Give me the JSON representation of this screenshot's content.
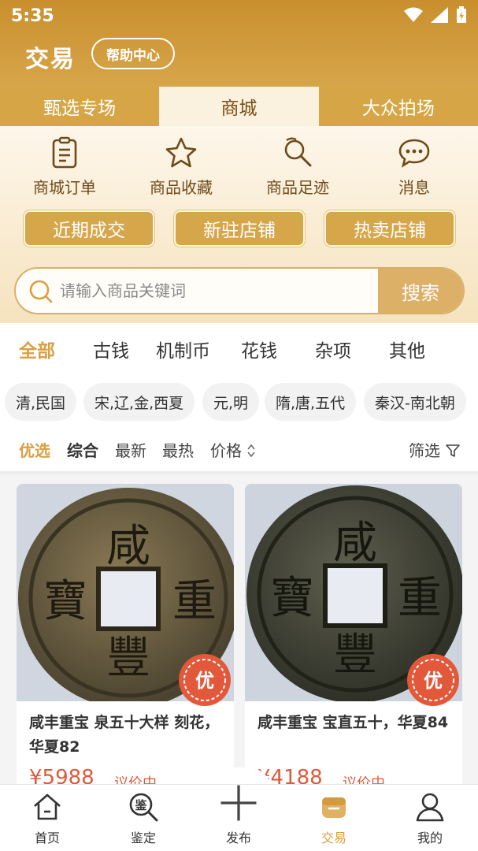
{
  "status_bar": {
    "time": "5:35"
  },
  "header": {
    "title": "交易",
    "help_label": "帮助中心"
  },
  "tabs": [
    {
      "label": "甄选专场",
      "active": false
    },
    {
      "label": "商城",
      "active": true
    },
    {
      "label": "大众拍场",
      "active": false
    }
  ],
  "quick_actions": [
    {
      "label": "商城订单",
      "icon": "order-icon"
    },
    {
      "label": "商品收藏",
      "icon": "star-icon"
    },
    {
      "label": "商品足迹",
      "icon": "footprint-icon"
    },
    {
      "label": "消息",
      "icon": "message-icon"
    }
  ],
  "action_buttons": [
    {
      "label": "近期成交"
    },
    {
      "label": "新驻店铺"
    },
    {
      "label": "热卖店铺"
    }
  ],
  "search": {
    "placeholder": "请输入商品关键词",
    "button_label": "搜索"
  },
  "categories": [
    "全部",
    "古钱",
    "机制币",
    "花钱",
    "杂项",
    "其他"
  ],
  "chips": [
    "清,民国",
    "宋,辽,金,西夏",
    "元,明",
    "隋,唐,五代",
    "秦汉-南北朝"
  ],
  "sort": {
    "options": [
      "优选",
      "综合",
      "最新",
      "最热",
      "价格"
    ],
    "filter_label": "筛选"
  },
  "products": [
    {
      "name": "咸丰重宝 泉五十大样 刻花，华夏82",
      "price": "¥5988",
      "price_note": "议价中",
      "badge": "优",
      "coin_chars": [
        "咸",
        "重",
        "豐",
        "寶"
      ]
    },
    {
      "name": "咸丰重宝 宝直五十，华夏84",
      "price": "¥4188",
      "price_note": "议价中",
      "badge": "优",
      "coin_chars": [
        "咸",
        "重",
        "豐",
        "寶"
      ]
    }
  ],
  "bottom_nav": [
    {
      "label": "首页",
      "icon": "home-icon"
    },
    {
      "label": "鉴定",
      "icon": "appraise-icon",
      "glyph": "鉴"
    },
    {
      "label": "发布",
      "icon": "plus-icon"
    },
    {
      "label": "交易",
      "icon": "trade-icon",
      "active": true
    },
    {
      "label": "我的",
      "icon": "user-icon"
    }
  ],
  "colors": {
    "gold": "#d6a64a",
    "accent": "#d9a043",
    "price": "#e2583a"
  }
}
